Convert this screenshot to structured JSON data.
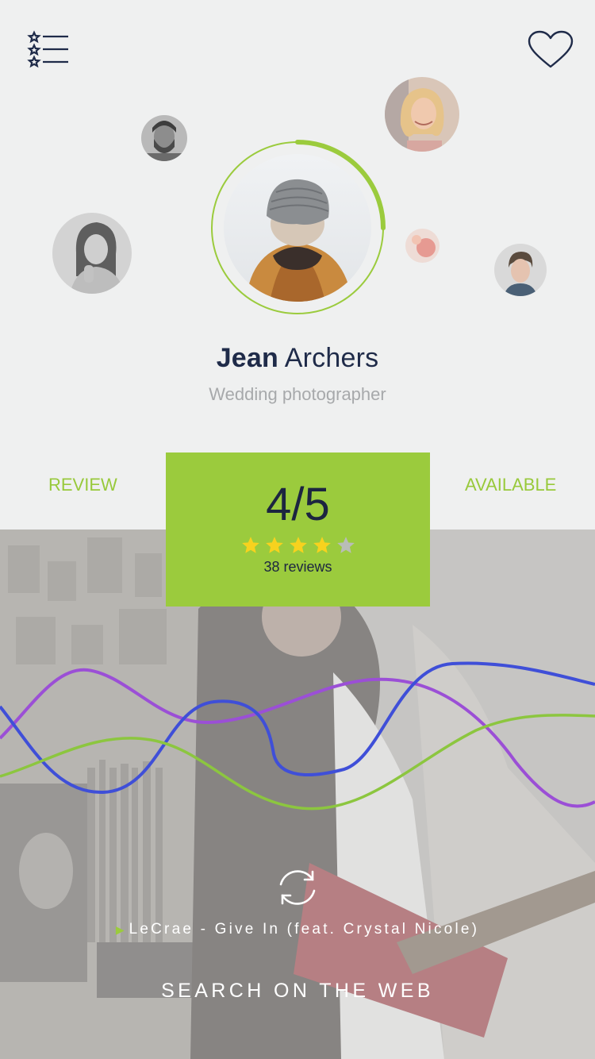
{
  "header": {
    "menu_icon": "star-list-icon",
    "favorite_icon": "heart-outline-icon"
  },
  "profile": {
    "first_name": "Jean",
    "last_name": "Archers",
    "role": "Wedding photographer",
    "progress": 0.25
  },
  "tabs": {
    "review": "REVIEW",
    "available": "AVAILABLE"
  },
  "rating": {
    "value": "4/5",
    "stars_filled": 4,
    "stars_total": 5,
    "reviews": "38 reviews"
  },
  "player": {
    "song": "LeCrae - Give In (feat. Crystal Nicole)",
    "play_icon": "play-triangle-icon",
    "refresh_icon": "refresh-icon"
  },
  "search_web_label": "SEARCH ON THE WEB",
  "colors": {
    "accent": "#9bcb3d",
    "navy": "#1f2b49",
    "wave_purple": "#9b4fd6",
    "wave_blue": "#3f4fd8",
    "wave_green": "#8cc63f"
  }
}
